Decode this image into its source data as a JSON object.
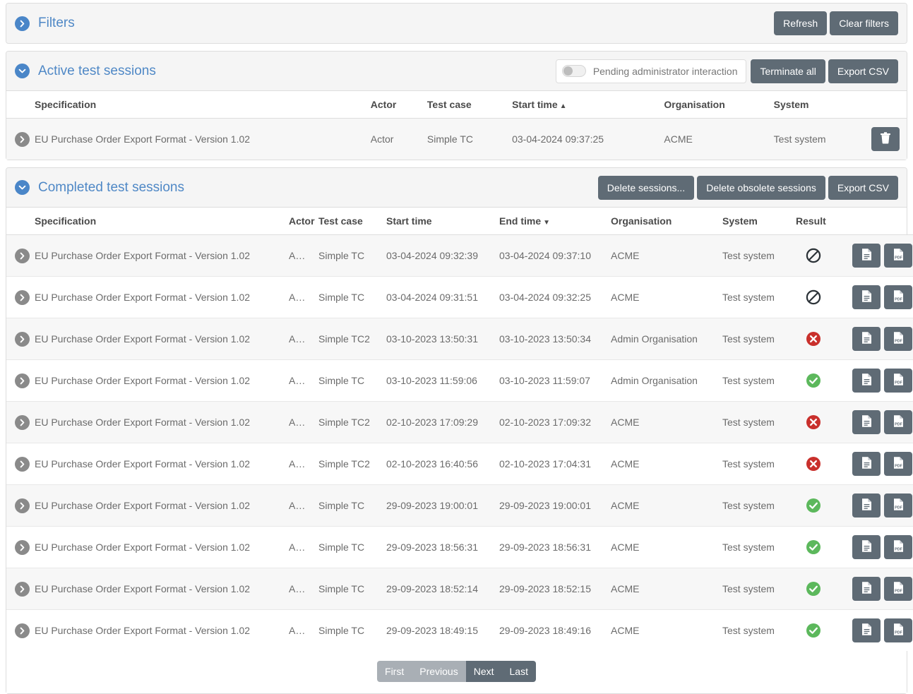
{
  "filters_panel": {
    "title": "Filters",
    "expand_icon": "chevron-right-icon",
    "buttons": {
      "refresh": "Refresh",
      "clear_filters": "Clear filters"
    }
  },
  "active_panel": {
    "title": "Active test sessions",
    "expand_icon": "chevron-down-icon",
    "toggle": {
      "label": "Pending administrator interaction",
      "state": "off"
    },
    "buttons": {
      "terminate_all": "Terminate all",
      "export_csv": "Export CSV"
    },
    "columns": [
      "Specification",
      "Actor",
      "Test case",
      "Start time",
      "Organisation",
      "System"
    ],
    "sort": {
      "column": "Start time",
      "direction": "asc",
      "arrow": "▲"
    },
    "rows": [
      {
        "specification": "EU Purchase Order Export Format - Version 1.02",
        "actor": "Actor",
        "test_case": "Simple TC",
        "start_time": "03-04-2024 09:37:25",
        "organisation": "ACME",
        "system": "Test system",
        "action_icon": "trash-icon"
      }
    ]
  },
  "completed_panel": {
    "title": "Completed test sessions",
    "expand_icon": "chevron-down-icon",
    "buttons": {
      "delete_sessions": "Delete sessions...",
      "delete_obsolete": "Delete obsolete sessions",
      "export_csv": "Export CSV"
    },
    "columns": [
      "Specification",
      "Actor",
      "Test case",
      "Start time",
      "End time",
      "Organisation",
      "System",
      "Result"
    ],
    "sort": {
      "column": "End time",
      "direction": "desc",
      "arrow": "▼"
    },
    "rows": [
      {
        "specification": "EU Purchase Order Export Format - Version 1.02",
        "actor": "Actor",
        "test_case": "Simple TC",
        "start_time": "03-04-2024 09:32:39",
        "end_time": "03-04-2024 09:37:10",
        "organisation": "ACME",
        "system": "Test system",
        "result": "undefined"
      },
      {
        "specification": "EU Purchase Order Export Format - Version 1.02",
        "actor": "Actor",
        "test_case": "Simple TC",
        "start_time": "03-04-2024 09:31:51",
        "end_time": "03-04-2024 09:32:25",
        "organisation": "ACME",
        "system": "Test system",
        "result": "undefined"
      },
      {
        "specification": "EU Purchase Order Export Format - Version 1.02",
        "actor": "Actor",
        "test_case": "Simple TC2",
        "start_time": "03-10-2023 13:50:31",
        "end_time": "03-10-2023 13:50:34",
        "organisation": "Admin Organisation",
        "system": "Test system",
        "result": "failure"
      },
      {
        "specification": "EU Purchase Order Export Format - Version 1.02",
        "actor": "Actor",
        "test_case": "Simple TC",
        "start_time": "03-10-2023 11:59:06",
        "end_time": "03-10-2023 11:59:07",
        "organisation": "Admin Organisation",
        "system": "Test system",
        "result": "success"
      },
      {
        "specification": "EU Purchase Order Export Format - Version 1.02",
        "actor": "Actor",
        "test_case": "Simple TC2",
        "start_time": "02-10-2023 17:09:29",
        "end_time": "02-10-2023 17:09:32",
        "organisation": "ACME",
        "system": "Test system",
        "result": "failure"
      },
      {
        "specification": "EU Purchase Order Export Format - Version 1.02",
        "actor": "Actor",
        "test_case": "Simple TC2",
        "start_time": "02-10-2023 16:40:56",
        "end_time": "02-10-2023 17:04:31",
        "organisation": "ACME",
        "system": "Test system",
        "result": "failure"
      },
      {
        "specification": "EU Purchase Order Export Format - Version 1.02",
        "actor": "Actor",
        "test_case": "Simple TC",
        "start_time": "29-09-2023 19:00:01",
        "end_time": "29-09-2023 19:00:01",
        "organisation": "ACME",
        "system": "Test system",
        "result": "success"
      },
      {
        "specification": "EU Purchase Order Export Format - Version 1.02",
        "actor": "Actor",
        "test_case": "Simple TC",
        "start_time": "29-09-2023 18:56:31",
        "end_time": "29-09-2023 18:56:31",
        "organisation": "ACME",
        "system": "Test system",
        "result": "success"
      },
      {
        "specification": "EU Purchase Order Export Format - Version 1.02",
        "actor": "Actor",
        "test_case": "Simple TC",
        "start_time": "29-09-2023 18:52:14",
        "end_time": "29-09-2023 18:52:15",
        "organisation": "ACME",
        "system": "Test system",
        "result": "success"
      },
      {
        "specification": "EU Purchase Order Export Format - Version 1.02",
        "actor": "Actor",
        "test_case": "Simple TC",
        "start_time": "29-09-2023 18:49:15",
        "end_time": "29-09-2023 18:49:16",
        "organisation": "ACME",
        "system": "Test system",
        "result": "success"
      }
    ],
    "row_actions": [
      {
        "icon": "report-document-icon"
      },
      {
        "icon": "pdf-document-icon"
      }
    ],
    "pagination": [
      {
        "label": "First",
        "state": "disabled"
      },
      {
        "label": "Previous",
        "state": "disabled"
      },
      {
        "label": "Next",
        "state": "enabled"
      },
      {
        "label": "Last",
        "state": "enabled"
      }
    ]
  },
  "colors": {
    "accent_blue": "#4a86c8",
    "button_grey": "#5f6b75",
    "success_green": "#5cb85c",
    "failure_red": "#c9302c",
    "undefined_dark": "#2c3338"
  }
}
